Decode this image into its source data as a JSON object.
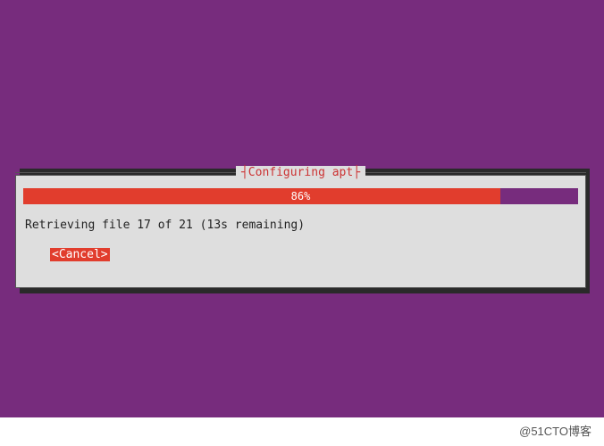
{
  "dialog": {
    "title": "Configuring apt",
    "progress_percent": 86,
    "progress_label": "86%",
    "status_text": "Retrieving file 17 of 21 (13s remaining)",
    "cancel_label": "<Cancel>"
  },
  "watermark": "@51CTO博客",
  "colors": {
    "background": "#772c7d",
    "dialog_bg": "#dedede",
    "accent_red": "#e13d2d",
    "title_red": "#cc3333"
  }
}
